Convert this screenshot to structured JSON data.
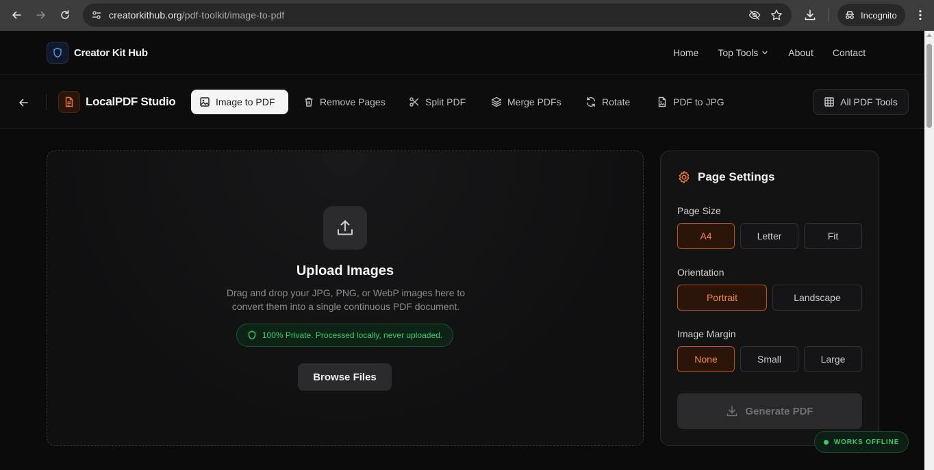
{
  "browser": {
    "url_host": "creatorkithub.org",
    "url_path": "/pdf-toolkit/image-to-pdf",
    "incognito_label": "Incognito"
  },
  "site": {
    "brand": "Creator Kit Hub",
    "nav": [
      {
        "label": "Home"
      },
      {
        "label": "Top Tools",
        "has_dropdown": true
      },
      {
        "label": "About"
      },
      {
        "label": "Contact"
      }
    ]
  },
  "toolbar": {
    "studio_name": "LocalPDF Studio",
    "tools": [
      {
        "label": "Image to PDF",
        "icon": "image-icon",
        "active": true
      },
      {
        "label": "Remove Pages",
        "icon": "trash-icon"
      },
      {
        "label": "Split PDF",
        "icon": "scissors-icon"
      },
      {
        "label": "Merge PDFs",
        "icon": "layers-icon"
      },
      {
        "label": "Rotate",
        "icon": "rotate-icon"
      },
      {
        "label": "PDF to JPG",
        "icon": "file-image-icon"
      }
    ],
    "all_tools_label": "All PDF Tools"
  },
  "upload": {
    "title": "Upload Images",
    "description": "Drag and drop your JPG, PNG, or WebP images here to convert them into a single continuous PDF document.",
    "privacy_note": "100% Private. Processed locally, never uploaded.",
    "browse_label": "Browse Files"
  },
  "settings": {
    "title": "Page Settings",
    "page_size": {
      "label": "Page Size",
      "options": [
        "A4",
        "Letter",
        "Fit"
      ],
      "selected": "A4"
    },
    "orientation": {
      "label": "Orientation",
      "options": [
        "Portrait",
        "Landscape"
      ],
      "selected": "Portrait"
    },
    "margin": {
      "label": "Image Margin",
      "options": [
        "None",
        "Small",
        "Large"
      ],
      "selected": "None"
    },
    "generate_label": "Generate PDF"
  },
  "offline_badge": "WORKS OFFLINE",
  "colors": {
    "accent": "#f07a22",
    "success": "#2fcf6a",
    "brand_blue": "#5b8fe8"
  }
}
